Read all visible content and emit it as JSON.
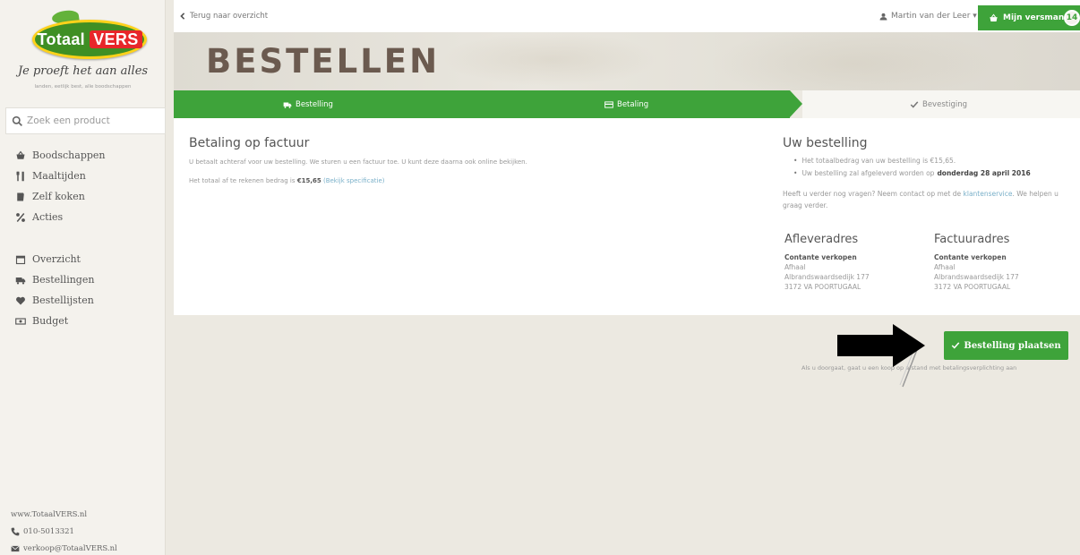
{
  "brand": {
    "logo_totaal": "Totaal",
    "logo_vers": "VERS",
    "tagline": "Je proeft het aan alles",
    "subline": "landen, eetlijk best, alle boodschappen"
  },
  "search": {
    "placeholder": "Zoek een product"
  },
  "sidebar": {
    "main_items": [
      {
        "label": "Boodschappen",
        "icon": "basket-icon"
      },
      {
        "label": "Maaltijden",
        "icon": "cutlery-icon"
      },
      {
        "label": "Zelf koken",
        "icon": "book-icon"
      },
      {
        "label": "Acties",
        "icon": "percent-icon"
      }
    ],
    "account_items": [
      {
        "label": "Overzicht",
        "icon": "calendar-icon"
      },
      {
        "label": "Bestellingen",
        "icon": "truck-icon"
      },
      {
        "label": "Bestellijsten",
        "icon": "heart-icon"
      },
      {
        "label": "Budget",
        "icon": "money-icon"
      }
    ],
    "footer": {
      "website": "www.TotaalVERS.nl",
      "phone": "010-5013321",
      "email": "verkoop@TotaalVERS.nl"
    }
  },
  "topbar": {
    "back_label": "Terug naar overzicht",
    "user_label": "Martin van der Leer ▾",
    "cart_label": "Mijn versmand",
    "cart_count": "14"
  },
  "hero": {
    "title": "BESTELLEN"
  },
  "steps": [
    {
      "label": "Bestelling",
      "state": "done",
      "icon": "truck-icon"
    },
    {
      "label": "Betaling",
      "state": "active",
      "icon": "credit-card-icon"
    },
    {
      "label": "Bevestiging",
      "state": "upcoming",
      "icon": "check-icon"
    }
  ],
  "payment": {
    "title": "Betaling op factuur",
    "description": "U betaalt achteraf voor uw bestelling. We sturen u een factuur toe. U kunt deze daarna ook online bekijken.",
    "total_prefix": "Het totaal af te rekenen bedrag is",
    "total_amount": "€15,65",
    "spec_link": "(Bekijk specificatie)"
  },
  "order": {
    "title": "Uw bestelling",
    "bullet_total": "Het totaalbedrag van uw bestelling is €15,65.",
    "bullet_delivery_prefix": "Uw bestelling zal afgeleverd worden op",
    "bullet_delivery_date": "donderdag 28 april 2016",
    "help_prefix": "Heeft u verder nog vragen? Neem contact op met de",
    "help_link": "klantenservice",
    "help_suffix": ". We helpen u graag verder."
  },
  "addresses": [
    {
      "title": "Afleveradres",
      "name": "Contante verkopen",
      "line1": "Afhaal",
      "line2": "Albrandswaardsedijk 177",
      "line3": "3172 VA POORTUGAAL"
    },
    {
      "title": "Factuuradres",
      "name": "Contante verkopen",
      "line1": "Afhaal",
      "line2": "Albrandswaardsedijk 177",
      "line3": "3172 VA POORTUGAAL"
    }
  ],
  "actions": {
    "place_order_label": "Bestelling plaatsen",
    "place_order_note": "Als u doorgaat, gaat u een koop op afstand met betalingsverplichting aan"
  },
  "colors": {
    "brand_green": "#3ea33a",
    "brand_yellow": "#ffd21a",
    "brand_red": "#e8262a",
    "link_blue": "#7ab0c9"
  }
}
